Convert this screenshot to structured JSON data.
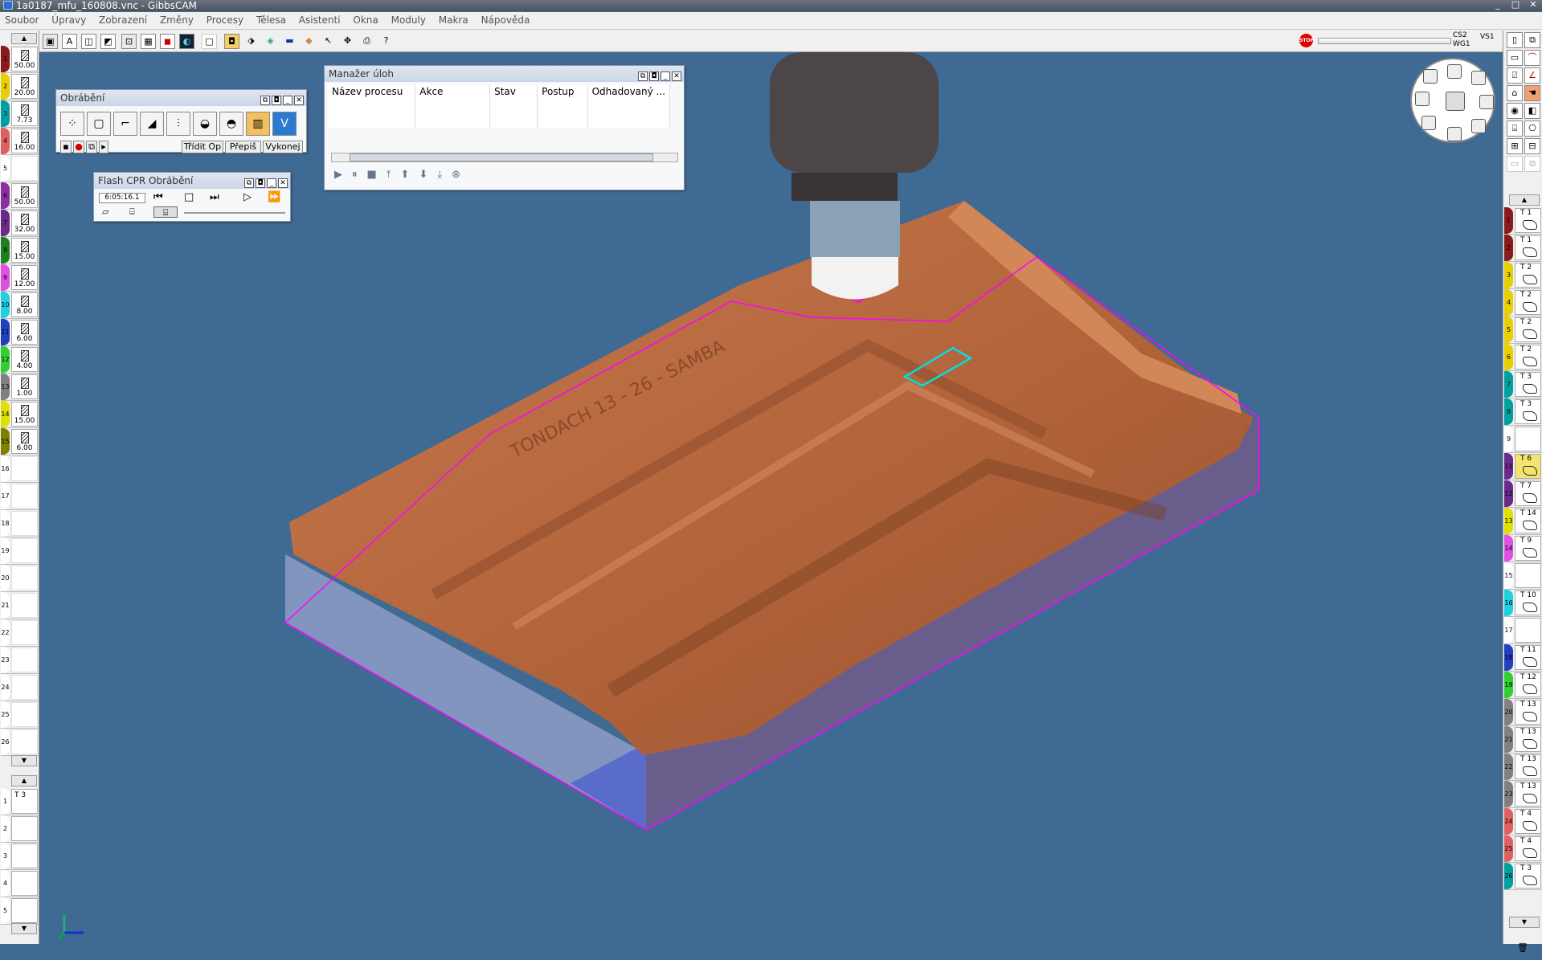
{
  "window": {
    "title": "1a0187_mfu_160808.vnc - GibbsCAM",
    "min": "_",
    "max": "□",
    "close": "✕"
  },
  "menu": [
    "Soubor",
    "Úpravy",
    "Zobrazení",
    "Změny",
    "Procesy",
    "Tělesa",
    "Asistenti",
    "Okna",
    "Moduly",
    "Makra",
    "Nápověda"
  ],
  "status": {
    "coord": "CS2",
    "wg": "WG1",
    "view": "VS1",
    "stop": "STOP"
  },
  "toolbar_icons": [
    "solid-view-icon",
    "wire-view-icon",
    "box-view-icon",
    "shade-icon",
    "select-icon",
    "grid-icon",
    "render-icon",
    "dark-render-icon",
    "blank-icon",
    "highlight-icon",
    "part-icon",
    "layer-icon",
    "tool-icon",
    "stock-icon",
    "pointer-icon",
    "move-icon",
    "print-icon",
    "help-icon"
  ],
  "tools_left": [
    {
      "n": "1",
      "v": "50.00",
      "c": "#8b1a1a"
    },
    {
      "n": "2",
      "v": "20.00",
      "c": "#e8d000"
    },
    {
      "n": "3",
      "v": "7.73",
      "c": "#00a0a0"
    },
    {
      "n": "4",
      "v": "16.00",
      "c": "#e06060"
    },
    {
      "n": "5",
      "v": "",
      "c": "#ffffff"
    },
    {
      "n": "6",
      "v": "50.00",
      "c": "#8b30a0"
    },
    {
      "n": "7",
      "v": "32.00",
      "c": "#6a2a8a"
    },
    {
      "n": "8",
      "v": "15.00",
      "c": "#208020"
    },
    {
      "n": "9",
      "v": "12.00",
      "c": "#e050e0"
    },
    {
      "n": "10",
      "v": "8.00",
      "c": "#20d0e0"
    },
    {
      "n": "11",
      "v": "6.00",
      "c": "#2040c0"
    },
    {
      "n": "12",
      "v": "4.00",
      "c": "#30d030"
    },
    {
      "n": "13",
      "v": "1.00",
      "c": "#808080"
    },
    {
      "n": "14",
      "v": "15.00",
      "c": "#e0e000"
    },
    {
      "n": "15",
      "v": "6.00",
      "c": "#808000"
    },
    {
      "n": "16",
      "v": "",
      "c": "#ffffff"
    },
    {
      "n": "17",
      "v": "",
      "c": "#ffffff"
    },
    {
      "n": "18",
      "v": "",
      "c": "#ffffff"
    },
    {
      "n": "19",
      "v": "",
      "c": "#ffffff"
    },
    {
      "n": "20",
      "v": "",
      "c": "#ffffff"
    },
    {
      "n": "21",
      "v": "",
      "c": "#ffffff"
    },
    {
      "n": "22",
      "v": "",
      "c": "#ffffff"
    },
    {
      "n": "23",
      "v": "",
      "c": "#ffffff"
    },
    {
      "n": "24",
      "v": "",
      "c": "#ffffff"
    },
    {
      "n": "25",
      "v": "",
      "c": "#ffffff"
    },
    {
      "n": "26",
      "v": "",
      "c": "#ffffff"
    }
  ],
  "process_left": [
    {
      "n": "1",
      "t": "T 3"
    },
    {
      "n": "2",
      "t": ""
    },
    {
      "n": "3",
      "t": ""
    },
    {
      "n": "4",
      "t": ""
    },
    {
      "n": "5",
      "t": ""
    }
  ],
  "ops_right": [
    {
      "n": "1",
      "t": "T 1",
      "c": "#8b1a1a",
      "sel": false
    },
    {
      "n": "2",
      "t": "T 1",
      "c": "#8b1a1a",
      "sel": false
    },
    {
      "n": "3",
      "t": "T 2",
      "c": "#e8d000",
      "sel": false
    },
    {
      "n": "4",
      "t": "T 2",
      "c": "#e8d000",
      "sel": false
    },
    {
      "n": "5",
      "t": "T 2",
      "c": "#e8d000",
      "sel": false
    },
    {
      "n": "6",
      "t": "T 2",
      "c": "#e8d000",
      "sel": false
    },
    {
      "n": "7",
      "t": "T 3",
      "c": "#00a0a0",
      "sel": false
    },
    {
      "n": "8",
      "t": "T 3",
      "c": "#00a0a0",
      "sel": false
    },
    {
      "n": "9",
      "t": "",
      "c": "#ffffff",
      "sel": false
    },
    {
      "n": "11",
      "t": "T 6",
      "c": "#6a2a8a",
      "sel": true
    },
    {
      "n": "12",
      "t": "T 7",
      "c": "#6a2a8a",
      "sel": false
    },
    {
      "n": "13",
      "t": "T 14",
      "c": "#e0e000",
      "sel": false
    },
    {
      "n": "14",
      "t": "T 9",
      "c": "#e050e0",
      "sel": false
    },
    {
      "n": "15",
      "t": "",
      "c": "#ffffff",
      "sel": false
    },
    {
      "n": "16",
      "t": "T 10",
      "c": "#20d0e0",
      "sel": false
    },
    {
      "n": "17",
      "t": "",
      "c": "#ffffff",
      "sel": false
    },
    {
      "n": "18",
      "t": "T 11",
      "c": "#2040c0",
      "sel": false
    },
    {
      "n": "19",
      "t": "T 12",
      "c": "#30d030",
      "sel": false
    },
    {
      "n": "20",
      "t": "T 13",
      "c": "#808080",
      "sel": false
    },
    {
      "n": "21",
      "t": "T 13",
      "c": "#808080",
      "sel": false
    },
    {
      "n": "22",
      "t": "T 13",
      "c": "#808080",
      "sel": false
    },
    {
      "n": "23",
      "t": "T 13",
      "c": "#808080",
      "sel": false
    },
    {
      "n": "24",
      "t": "T 4",
      "c": "#e06060",
      "sel": false
    },
    {
      "n": "25",
      "t": "T 4",
      "c": "#e06060",
      "sel": false
    },
    {
      "n": "26",
      "t": "T 3",
      "c": "#00a0a0",
      "sel": false
    }
  ],
  "obrabeni": {
    "title": "Obrábění",
    "sort": "Třídit Op",
    "rewrite": "Přepiš",
    "execute": "Vykonej",
    "proc_icons": [
      "drill-icon",
      "contour-icon",
      "pocket-icon",
      "thread-icon",
      "surface-icon",
      "3d-icon",
      "rough-icon",
      "volumill-icon",
      "v-icon"
    ]
  },
  "flash": {
    "title": "Flash CPR Obrábění",
    "time": "6:05:16.1"
  },
  "tasks": {
    "title": "Manažer úloh",
    "columns": [
      "Název procesu",
      "Akce",
      "Stav",
      "Postup",
      "Odhadovaný ..."
    ]
  },
  "part_text": "TONDACH 13 - 26 - SAMBA",
  "colors": {
    "background": "#3f6a93",
    "part": "#b8673f",
    "stock": "#8f9ec8",
    "toolpath": "#ff00ff",
    "selected": "#00e0e0"
  }
}
